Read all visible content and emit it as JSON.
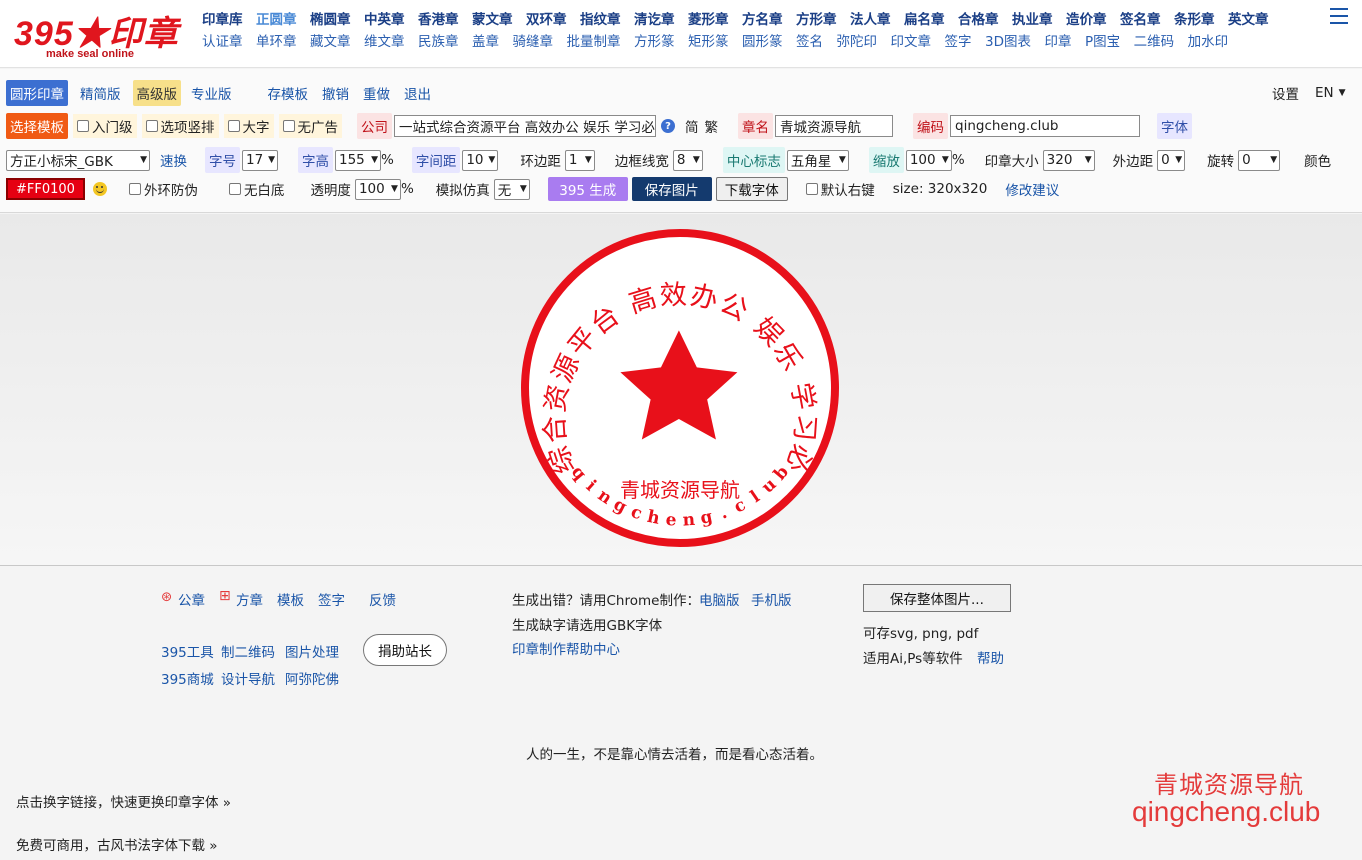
{
  "header": {
    "logo_text": "395★印章",
    "logo_sub": "make seal online",
    "nav_row1": [
      "印章库",
      "正圆章",
      "椭圆章",
      "中英章",
      "香港章",
      "蒙文章",
      "双环章",
      "指纹章",
      "清讫章",
      "菱形章",
      "方名章",
      "方形章",
      "法人章",
      "扁名章",
      "合格章",
      "执业章",
      "造价章",
      "签名章",
      "条形章",
      "英文章"
    ],
    "nav_row1_active": "正圆章",
    "nav_row2": [
      "认证章",
      "单环章",
      "藏文章",
      "维文章",
      "民族章",
      "盖章",
      "骑缝章",
      "批量制章",
      "方形篆",
      "矩形篆",
      "圆形篆",
      "签名",
      "弥陀印",
      "印文章",
      "签字",
      "3D图表",
      "印章",
      "P图宝",
      "二维码",
      "加水印"
    ]
  },
  "toolbar": {
    "row1": {
      "round_seal": "圆形印章",
      "simple": "精简版",
      "advanced": "高级版",
      "pro": "专业版",
      "save_template": "存模板",
      "undo": "撤销",
      "redo": "重做",
      "exit": "退出",
      "settings": "设置",
      "lang": "EN"
    },
    "row2": {
      "choose_template": "选择模板",
      "beginner": "入门级",
      "vertical_options": "选项竖排",
      "big_text": "大字",
      "no_ads": "无广告",
      "company_label": "公司",
      "company_value": "一站式综合资源平台 高效办公 娱乐 学习必备导航",
      "simplified": "简",
      "traditional": "繁",
      "seal_name_label": "章名",
      "seal_name_value": "青城资源导航",
      "code_label": "编码",
      "code_value": "qingcheng.club",
      "font_label": "字体"
    },
    "row3": {
      "font_value": "方正小标宋_GBK",
      "quick_swap": "速换",
      "font_size_label": "字号",
      "font_size_value": "17",
      "font_height_label": "字高",
      "font_height_value": "155",
      "percent": "%",
      "spacing_label": "字间距",
      "spacing_value": "10",
      "ring_margin_label": "环边距",
      "ring_margin_value": "1",
      "border_width_label": "边框线宽",
      "border_width_value": "8",
      "center_mark_label": "中心标志",
      "center_mark_value": "五角星",
      "scale_label": "缩放",
      "scale_value": "100",
      "seal_size_label": "印章大小",
      "seal_size_value": "320",
      "outer_margin_label": "外边距",
      "outer_margin_value": "0",
      "rotate_label": "旋转",
      "rotate_value": "0",
      "color_label": "颜色"
    },
    "row4": {
      "color_value": "#FF0100",
      "anti_fake": "外环防伪",
      "no_white_bg": "无白底",
      "opacity_label": "透明度",
      "opacity_value": "100",
      "percent": "%",
      "simulate_label": "模拟仿真",
      "simulate_value": "无",
      "generate": "395 生成",
      "save_image": "保存图片",
      "download_font": "下载字体",
      "default_right_key": "默认右键",
      "size_text": "size: 320x320",
      "suggest": "修改建议"
    }
  },
  "seal": {
    "color": "#e8101a",
    "top_text": "一站式综合资源平台 高效办公 娱乐 学习必备导航",
    "name": "青城资源导航",
    "code": "qingcheng.club",
    "center_mark": "star-icon"
  },
  "footer": {
    "official_seal": "公章",
    "square_seal": "方章",
    "template": "模板",
    "signature": "签字",
    "feedback": "反馈",
    "tools": "395工具",
    "qr": "制二维码",
    "image_process": "图片处理",
    "donate": "捐助站长",
    "mall": "395商城",
    "design_nav": "设计导航",
    "amitabha": "阿弥陀佛",
    "error_text": "生成出错？请用Chrome制作：",
    "pc_version": "电脑版",
    "mobile_version": "手机版",
    "gbk_hint": "生成缺字请选用GBK字体",
    "help_center": "印章制作帮助中心",
    "save_whole": "保存整体图片...",
    "formats": "可存svg, png, pdf",
    "software": "适用Ai,Ps等软件",
    "help": "帮助",
    "quote": "人的一生，不是靠心情去活着，而是看心态活着。",
    "font_link": "点击换字链接，快速更换印章字体 »",
    "free_font": "免费可商用，古风书法字体下载 »",
    "watermark1": "青城资源导航",
    "watermark2": "qingcheng.club"
  }
}
